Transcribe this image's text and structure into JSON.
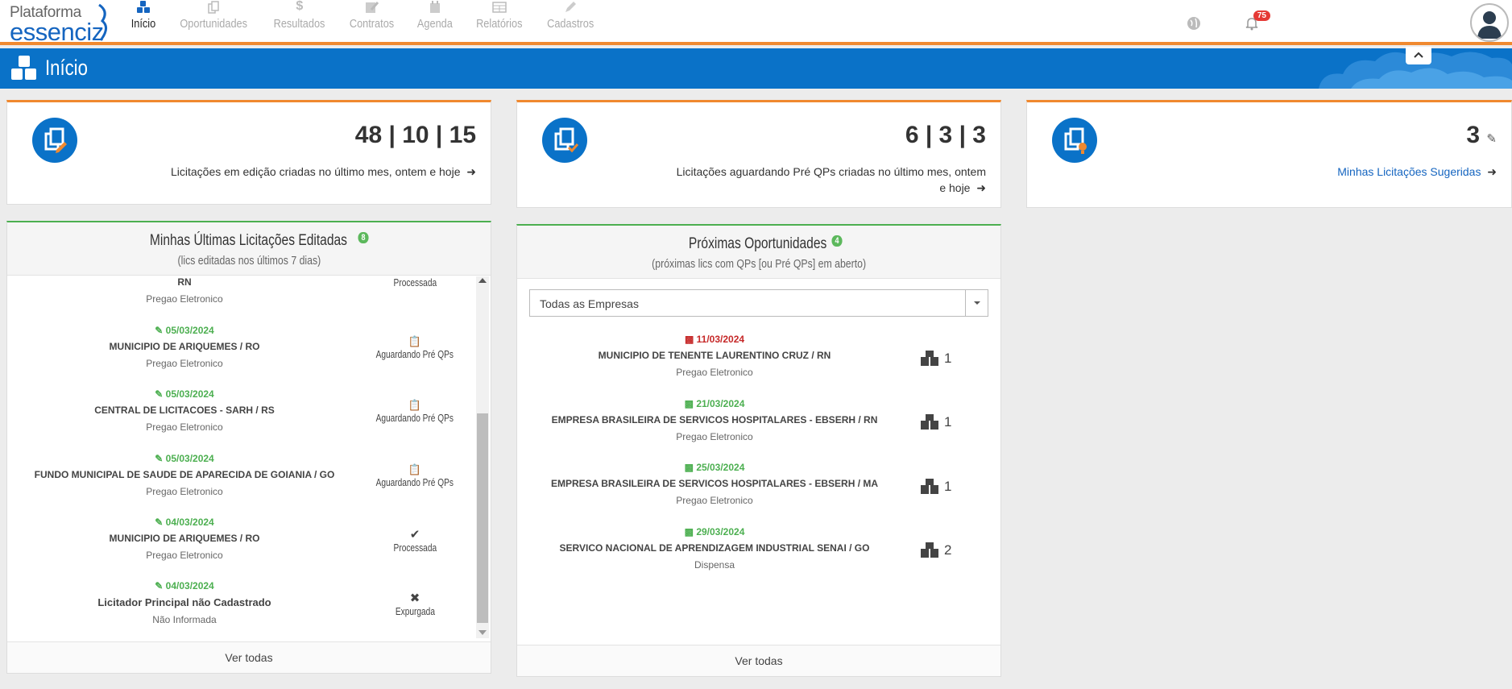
{
  "app": {
    "logo_line1": "Plataforma",
    "logo_line2": "essenciz"
  },
  "nav": [
    {
      "label": "Início",
      "icon": "cubes-icon",
      "active": true
    },
    {
      "label": "Oportunidades",
      "icon": "copy-icon"
    },
    {
      "label": "Resultados",
      "icon": "dollar-icon"
    },
    {
      "label": "Contratos",
      "icon": "edit-icon"
    },
    {
      "label": "Agenda",
      "icon": "calendar-icon"
    },
    {
      "label": "Relatórios",
      "icon": "table-icon"
    },
    {
      "label": "Cadastros",
      "icon": "pencil-icon"
    }
  ],
  "header": {
    "notifications": "75"
  },
  "page": {
    "title": "Início"
  },
  "stats": [
    {
      "value": "48 | 10 | 15",
      "text": "Licitações em edição criadas no último mes, ontem e hoje",
      "icon": "copy-edit-icon"
    },
    {
      "value": "6 | 3 | 3",
      "text_line1": "Licitações aguardando Pré QPs criadas no último mes, ontem",
      "text_line2": "e hoje",
      "icon": "copy-check-icon"
    },
    {
      "value": "3",
      "text": "Minhas Licitações Sugeridas",
      "icon": "copy-bulb-icon"
    }
  ],
  "edited": {
    "title": "Minhas Últimas Licitações Editadas",
    "count": "8",
    "subtitle": "(lics editadas nos últimos 7 dias)",
    "footer": "Ver todas",
    "partial": {
      "org": "RN",
      "mod": "Pregao Eletronico",
      "status": "Processada"
    },
    "items": [
      {
        "date": "05/03/2024",
        "org": "MUNICIPIO DE ARIQUEMES / RO",
        "mod": "Pregao Eletronico",
        "status": "Aguardando Pré QPs",
        "status_icon": "clipboard-icon"
      },
      {
        "date": "05/03/2024",
        "org": "CENTRAL DE LICITACOES - SARH / RS",
        "mod": "Pregao Eletronico",
        "status": "Aguardando Pré QPs",
        "status_icon": "clipboard-icon"
      },
      {
        "date": "05/03/2024",
        "org": "FUNDO MUNICIPAL DE SAUDE DE APARECIDA DE GOIANIA / GO",
        "mod": "Pregao Eletronico",
        "status": "Aguardando Pré QPs",
        "status_icon": "clipboard-icon"
      },
      {
        "date": "04/03/2024",
        "org": "MUNICIPIO DE ARIQUEMES / RO",
        "mod": "Pregao Eletronico",
        "status": "Processada",
        "status_icon": "check-circle-icon"
      },
      {
        "date": "04/03/2024",
        "org": "Licitador Principal não Cadastrado",
        "mod": "Não Informada",
        "status": "Expurgada",
        "status_icon": "times-circle-icon"
      }
    ]
  },
  "opps": {
    "title": "Próximas Oportunidades",
    "count": "4",
    "subtitle": "(próximas lics com QPs [ou Pré QPs] em aberto)",
    "select": "Todas as Empresas",
    "footer": "Ver todas",
    "items": [
      {
        "date": "11/03/2024",
        "urgent": true,
        "org": "MUNICIPIO DE TENENTE LAURENTINO CRUZ / RN",
        "mod": "Pregao Eletronico",
        "qty": "1"
      },
      {
        "date": "21/03/2024",
        "org": "EMPRESA BRASILEIRA DE SERVICOS HOSPITALARES - EBSERH / RN",
        "mod": "Pregao Eletronico",
        "qty": "1"
      },
      {
        "date": "25/03/2024",
        "org": "EMPRESA BRASILEIRA DE SERVICOS HOSPITALARES - EBSERH / MA",
        "mod": "Pregao Eletronico",
        "qty": "1"
      },
      {
        "date": "29/03/2024",
        "org": "SERVICO NACIONAL DE APRENDIZAGEM INDUSTRIAL SENAI / GO",
        "mod": "Dispensa",
        "qty": "2"
      }
    ]
  },
  "colors": {
    "primary": "#0a72c8",
    "accent": "#f0892f",
    "success": "#4caf50",
    "danger": "#c62828"
  }
}
